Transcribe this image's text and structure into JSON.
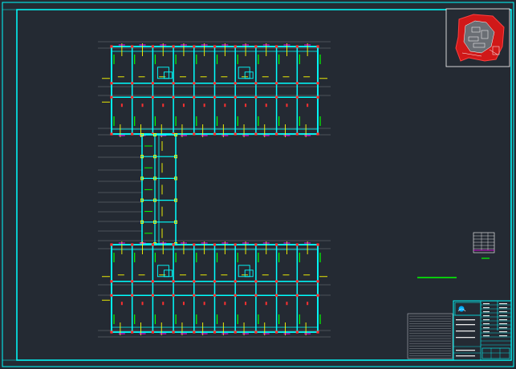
{
  "drawing": {
    "colors": {
      "background": "#242a33",
      "border": "#00ffff",
      "beam": "#00ffff",
      "column": "#ff3030",
      "rebar_note": "#ffff00",
      "wall_tag": "#00ff00",
      "dimension": "#ff00ff",
      "axis": "#c8c8c8",
      "site_boundary": "#ff0000",
      "legend_line": "#00ff00"
    },
    "top_wing_bays": 10,
    "bottom_wing_bays": 10,
    "connector_bays": 5,
    "title_block": {
      "rows": 12,
      "text_lines": 9
    }
  }
}
